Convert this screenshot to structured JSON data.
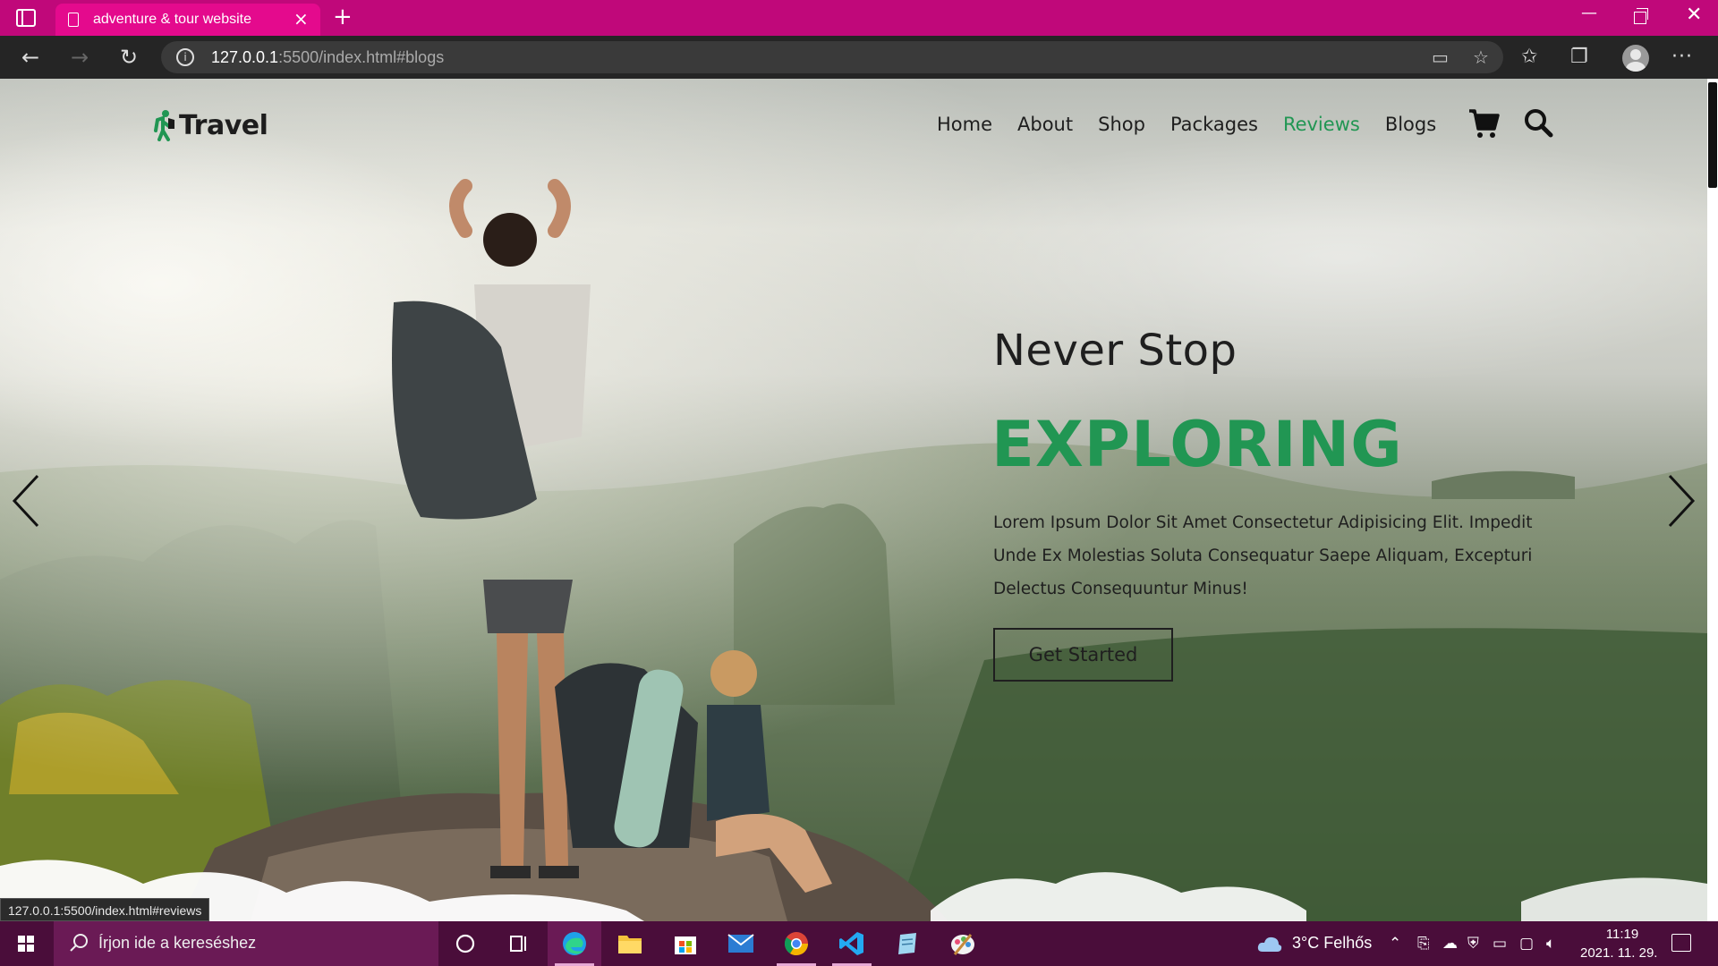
{
  "browser": {
    "tab_title": "adventure & tour website",
    "tab_close": "×",
    "new_tab": "+",
    "address": {
      "host": "127.0.0.1",
      "rest": ":5500/index.html#blogs"
    },
    "status_url": "127.0.0.1:5500/index.html#reviews",
    "window_controls": {
      "minimize": "—",
      "close": "✕"
    }
  },
  "site": {
    "logo_text": "Travel",
    "nav": [
      {
        "label": "Home",
        "active": false
      },
      {
        "label": "About",
        "active": false
      },
      {
        "label": "Shop",
        "active": false
      },
      {
        "label": "Packages",
        "active": false
      },
      {
        "label": "Reviews",
        "active": true
      },
      {
        "label": "Blogs",
        "active": false
      }
    ],
    "hero": {
      "subtitle": "Never Stop",
      "title": "EXPLORING",
      "description": "Lorem Ipsum Dolor Sit Amet Consectetur Adipisicing Elit. Impedit Unde Ex Molestias Soluta Consequatur Saepe Aliquam, Excepturi Delectus Consequuntur Minus!",
      "button_label": "Get Started"
    },
    "colors": {
      "accent": "#219653",
      "text": "#1f1f1f"
    }
  },
  "taskbar": {
    "search_placeholder": "Írjon ide a kereséshez",
    "weather": "3°C  Felhős",
    "time": "11:19",
    "date": "2021. 11. 29.",
    "apps": [
      "cortana-icon",
      "task-view-icon",
      "edge-icon",
      "file-explorer-icon",
      "store-icon",
      "mail-icon",
      "chrome-icon",
      "vscode-icon",
      "notepad-icon",
      "paint-icon"
    ]
  }
}
